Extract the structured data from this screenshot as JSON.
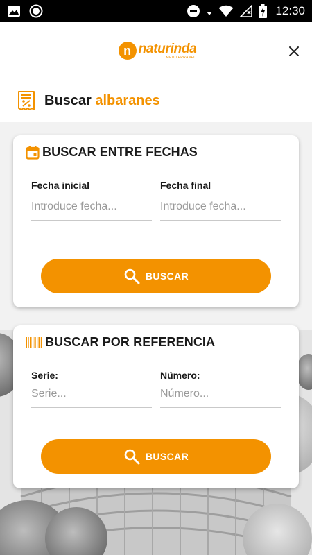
{
  "status_bar": {
    "time": "12:30"
  },
  "header": {
    "logo_text": "naturinda",
    "logo_sub": "MEDITERRANEO",
    "logo_letter": "n"
  },
  "title": {
    "prefix": "Buscar",
    "accent": "albaranes"
  },
  "date_search": {
    "title": "BUSCAR ENTRE FECHAS",
    "start_label": "Fecha inicial",
    "start_placeholder": "Introduce fecha...",
    "end_label": "Fecha final",
    "end_placeholder": "Introduce fecha...",
    "button_label": "BUSCAR"
  },
  "reference_search": {
    "title": "BUSCAR POR REFERENCIA",
    "series_label": "Serie:",
    "series_placeholder": "Serie...",
    "number_label": "Número:",
    "number_placeholder": "Número...",
    "button_label": "BUSCAR"
  },
  "colors": {
    "accent": "#f39200",
    "status_bar": "#000000",
    "text": "#1a1a1a"
  }
}
